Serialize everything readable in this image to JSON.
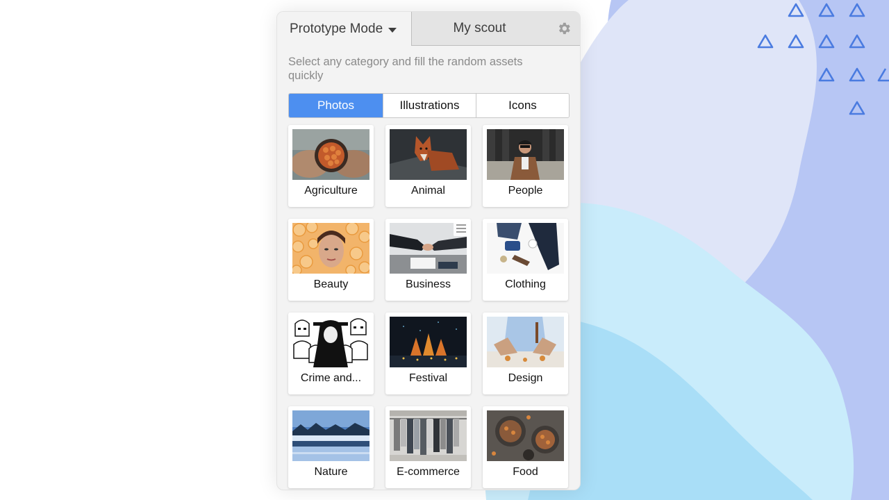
{
  "header": {
    "mode_label": "Prototype Mode",
    "scout_label": "My scout"
  },
  "hint": "Select any category and fill the random assets quickly",
  "asset_tabs": [
    {
      "label": "Photos",
      "active": true
    },
    {
      "label": "Illustrations",
      "active": false
    },
    {
      "label": "Icons",
      "active": false
    }
  ],
  "categories": [
    {
      "label": "Agriculture"
    },
    {
      "label": "Animal"
    },
    {
      "label": "People"
    },
    {
      "label": "Beauty"
    },
    {
      "label": "Business"
    },
    {
      "label": "Clothing"
    },
    {
      "label": "Crime and..."
    },
    {
      "label": "Festival"
    },
    {
      "label": "Design"
    },
    {
      "label": "Nature"
    },
    {
      "label": "E-commerce"
    },
    {
      "label": "Food"
    }
  ],
  "colors": {
    "accent": "#4d8ff0",
    "panel_bg": "#f3f3f3",
    "tab_inactive_bg": "#e4e4e4",
    "triangle_stroke": "#4a7be0"
  },
  "icons": [
    "chevron-down-icon",
    "gear-icon",
    "menu-icon",
    "triangle-icon"
  ]
}
